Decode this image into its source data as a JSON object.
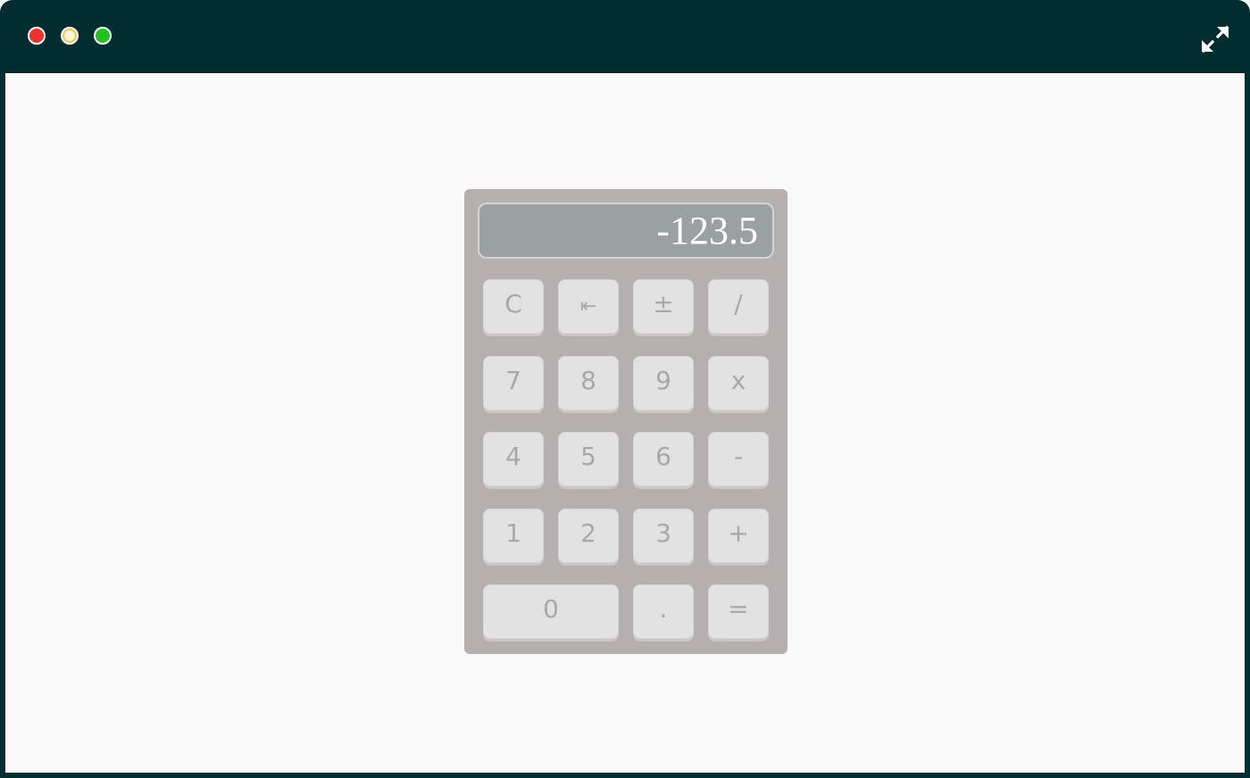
{
  "window": {
    "controls": [
      "close",
      "minimize",
      "zoom"
    ],
    "expand_icon": "expand-arrows-icon",
    "colors": {
      "titlebar": "#012d30",
      "close": "#f0302a",
      "minimize": "#f6c84a",
      "zoom": "#21c21f"
    }
  },
  "calculator": {
    "display": "-123.5",
    "keys": {
      "clear": "C",
      "backspace": "⇤",
      "sign": "±",
      "divide": "/",
      "seven": "7",
      "eight": "8",
      "nine": "9",
      "multiply": "x",
      "four": "4",
      "five": "5",
      "six": "6",
      "subtract": "-",
      "one": "1",
      "two": "2",
      "three": "3",
      "add": "+",
      "zero": "0",
      "decimal": ".",
      "equals": "="
    },
    "colors": {
      "body": "#b5afaf",
      "display": "#9ba1a2",
      "key": "#e2e2e2",
      "key_text": "#a8a8a8"
    }
  }
}
